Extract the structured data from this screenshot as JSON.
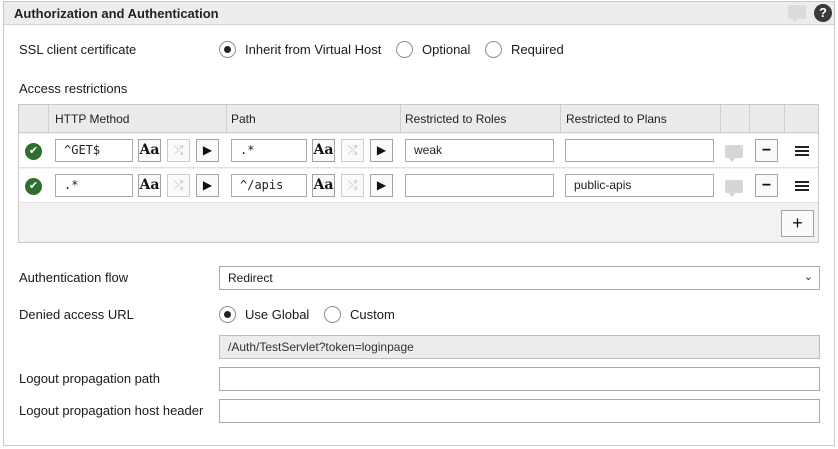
{
  "panel": {
    "title": "Authorization and Authentication",
    "help_symbol": "?"
  },
  "ssl": {
    "label": "SSL client certificate",
    "options": [
      "Inherit from Virtual Host",
      "Optional",
      "Required"
    ],
    "selected": "Inherit from Virtual Host"
  },
  "access": {
    "label": "Access restrictions",
    "columns": [
      "HTTP Method",
      "Path",
      "Restricted to Roles",
      "Restricted to Plans"
    ],
    "rows": [
      {
        "method": "^GET$",
        "path": ".*",
        "roles": "weak",
        "plans": ""
      },
      {
        "method": ".*",
        "path": "^/apis",
        "roles": "",
        "plans": "public-apis"
      }
    ],
    "case_symbol": "Aa",
    "shuffle_symbol": "⤮",
    "play_symbol": "▶",
    "remove_symbol": "−",
    "add_symbol": "+",
    "check_symbol": "✔"
  },
  "auth_flow": {
    "label": "Authentication flow",
    "value": "Redirect"
  },
  "denied": {
    "label": "Denied access URL",
    "options": [
      "Use Global",
      "Custom"
    ],
    "selected": "Use Global",
    "value": "/Auth/TestServlet?token=loginpage"
  },
  "logout_path": {
    "label": "Logout propagation path",
    "value": ""
  },
  "logout_host": {
    "label": "Logout propagation host header",
    "value": ""
  },
  "colors": {
    "header_bg": "#ededed",
    "check_green": "#2e6e2e",
    "border": "#c8c8c8"
  }
}
